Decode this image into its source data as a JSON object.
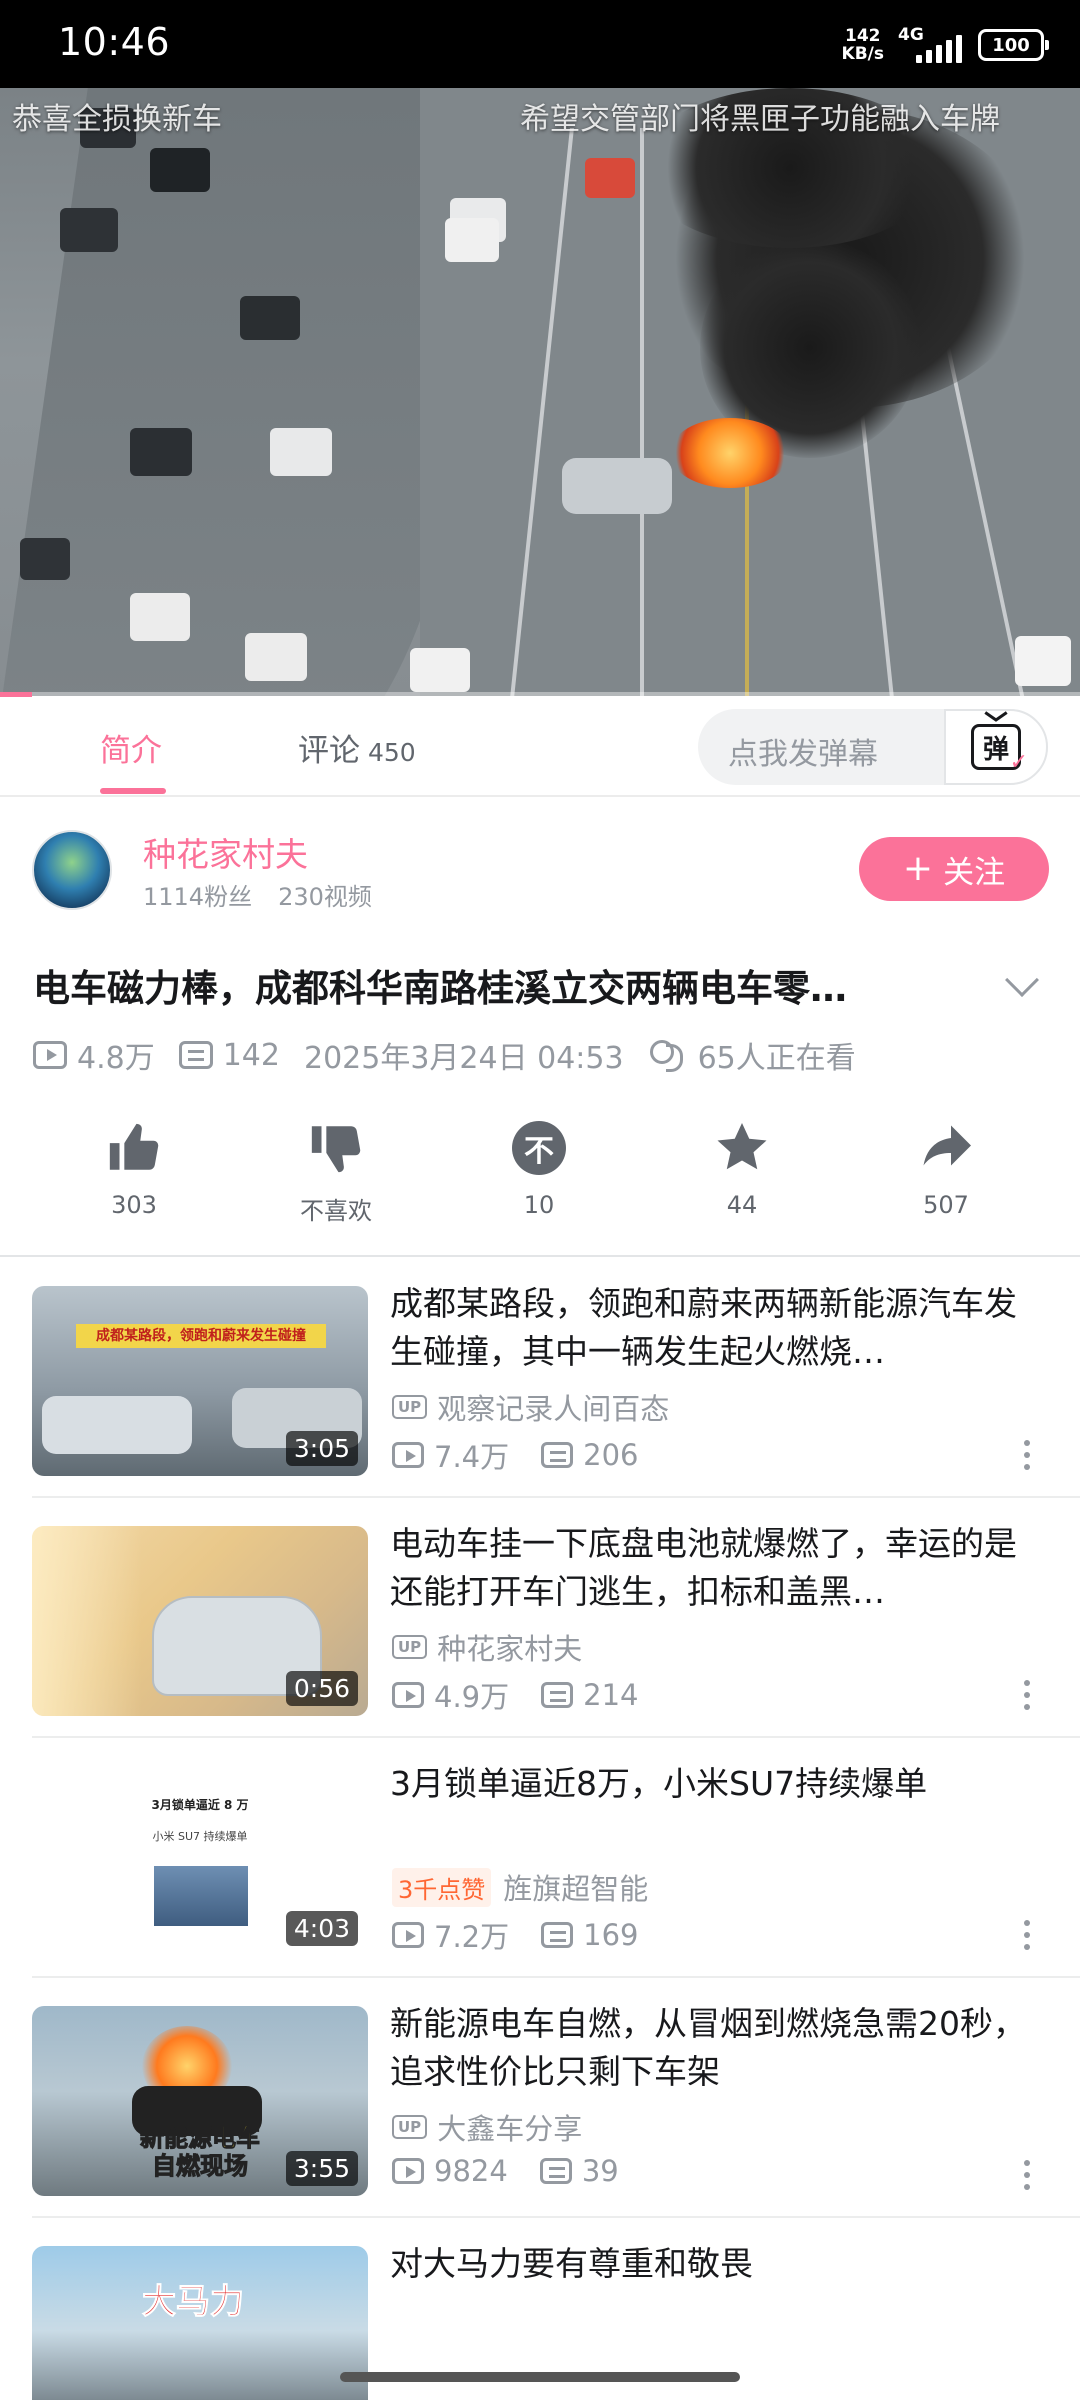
{
  "status_bar": {
    "time": "10:46",
    "net_speed_value": "142",
    "net_speed_unit": "KB/s",
    "network": "4G",
    "battery": "100"
  },
  "video": {
    "overlay_left": "恭喜全损换新车",
    "overlay_right": "希望交管部门将黑匣子功能融入车牌",
    "progress_fraction": 0.03
  },
  "tabs": [
    {
      "label": "简介",
      "active": true
    },
    {
      "label": "评论",
      "count": "450",
      "active": false
    }
  ],
  "danmaku": {
    "placeholder": "点我发弹幕",
    "button_glyph": "弹"
  },
  "uploader": {
    "name": "种花家村夫",
    "fans": "1114粉丝",
    "videos": "230视频",
    "follow_label": "关注"
  },
  "video_info": {
    "title": "电车磁力棒，成都科华南路桂溪立交两辆电车零…",
    "views": "4.8万",
    "danmaku_count": "142",
    "date": "2025年3月24日 04:53",
    "watching": "65人正在看"
  },
  "actions": [
    {
      "icon": "thumb-up-icon",
      "label": "303"
    },
    {
      "icon": "thumb-down-icon",
      "label": "不喜欢"
    },
    {
      "icon": "coin-icon",
      "label": "10"
    },
    {
      "icon": "star-icon",
      "label": "44"
    },
    {
      "icon": "share-icon",
      "label": "507"
    }
  ],
  "feed": [
    {
      "title": "成都某路段，领跑和蔚来两辆新能源汽车发生碰撞，其中一辆发生起火燃烧…",
      "author": "观察记录人间百态",
      "views": "7.4万",
      "danmaku": "206",
      "duration": "3:05",
      "thumb_caption": "成都某路段，领跑和蔚来发生碰撞"
    },
    {
      "title": "电动车挂一下底盘电池就爆燃了，幸运的是还能打开车门逃生，扣标和盖黑…",
      "author": "种花家村夫",
      "views": "4.9万",
      "danmaku": "214",
      "duration": "0:56"
    },
    {
      "title": "3月锁单逼近8万，小米SU7持续爆单",
      "badge": "3千点赞",
      "author": "旌旗超智能",
      "views": "7.2万",
      "danmaku": "169",
      "duration": "4:03",
      "thumb_caption": "3月锁单逼近 8 万",
      "thumb_subcaption": "小米 SU7 持续爆单"
    },
    {
      "title": "新能源电车自燃，从冒烟到燃烧急需20秒，追求性价比只剩下车架",
      "author": "大鑫车分享",
      "views": "9824",
      "danmaku": "39",
      "duration": "3:55",
      "thumb_caption": "新能源电车\n自燃现场"
    },
    {
      "title": "对大马力要有尊重和敬畏",
      "thumb_caption": "大马力"
    }
  ],
  "colors": {
    "accent": "#fb7299",
    "text_secondary": "#9499a0",
    "text_primary": "#18191c"
  }
}
